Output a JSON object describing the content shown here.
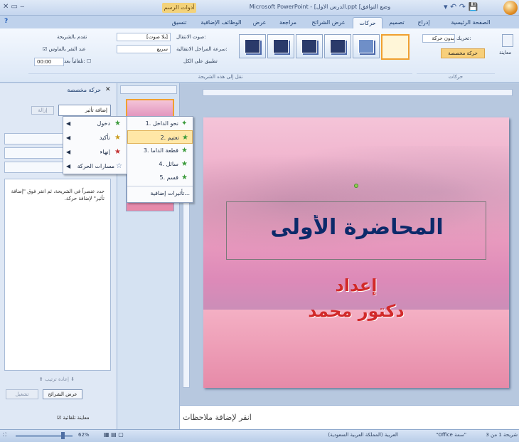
{
  "window": {
    "title": "Microsoft PowerPoint - [الدرس الاول.ppt [وضع التوافق",
    "drawing_tools_tab": "أدوات الرسم"
  },
  "ribbon": {
    "tabs": [
      "الصفحة الرئيسية",
      "إدراج",
      "تصميم",
      "حركات",
      "عرض الشرائح",
      "مراجعة",
      "عرض",
      "الوظائف الإضافية",
      "تنسيق"
    ],
    "active_tab": "حركات",
    "preview_label": "معاينة",
    "animate_label": "تحريك:",
    "animate_value": "بدون حركة",
    "custom_animation_label": "حركة مخصصة",
    "animations_group": "حركات",
    "transition_sound_label": "صوت الانتقال:",
    "transition_sound_value": "[بلا صوت]",
    "transition_speed_label": "سرعة المراحل الانتقالية:",
    "transition_speed_value": "سريع",
    "apply_all_label": "تطبيق على الكل",
    "advance_slide_label": "تقدم بالشريحة",
    "on_mouse_click_label": "عند النقر بالماوس",
    "auto_after_label": "تلقائياً بعد:",
    "auto_after_value": "00:00",
    "transition_group": "نقل إلى هذه الشريحة"
  },
  "task_pane": {
    "title": "حركة مخصصة",
    "add_effect_label": "إضافة تأثير",
    "remove_label": "إزالة",
    "hint": "حدد عنصراً في الشريحة، ثم انقر فوق \"إضافة تأثير\" لإضافة حركة.",
    "reorder_label": "إعادة ترتيب",
    "play_label": "تشغيل",
    "slideshow_label": "عرض الشرائح",
    "autopreview_label": "معاينة تلقائية"
  },
  "add_effect_menu": {
    "items": [
      {
        "label": "دخول",
        "color": "#3a9a3a"
      },
      {
        "label": "تأكيد",
        "color": "#c99a1a"
      },
      {
        "label": "إنهاء",
        "color": "#c23030"
      },
      {
        "label": "مسارات الحركة",
        "color": "#5577aa"
      }
    ]
  },
  "entrance_submenu": {
    "items": [
      "1. نحو الداخل",
      "2. تعتيم",
      "3. قطعة الداما",
      "4. سائل",
      "5. قسم",
      "تأثيرات إضافية..."
    ],
    "highlighted_index": 1
  },
  "slide": {
    "title": "المحاضرة الأولى",
    "subtitle_line1": "إعداد",
    "subtitle_line2": "دكتور محمد"
  },
  "notes": {
    "placeholder": "انقر لإضافة ملاحظات"
  },
  "statusbar": {
    "slide_info": "شريحة 1 من 3",
    "theme": "\"Office سمة\"",
    "language": "العربية (المملكة العربية السعودية)",
    "zoom": "62%"
  }
}
